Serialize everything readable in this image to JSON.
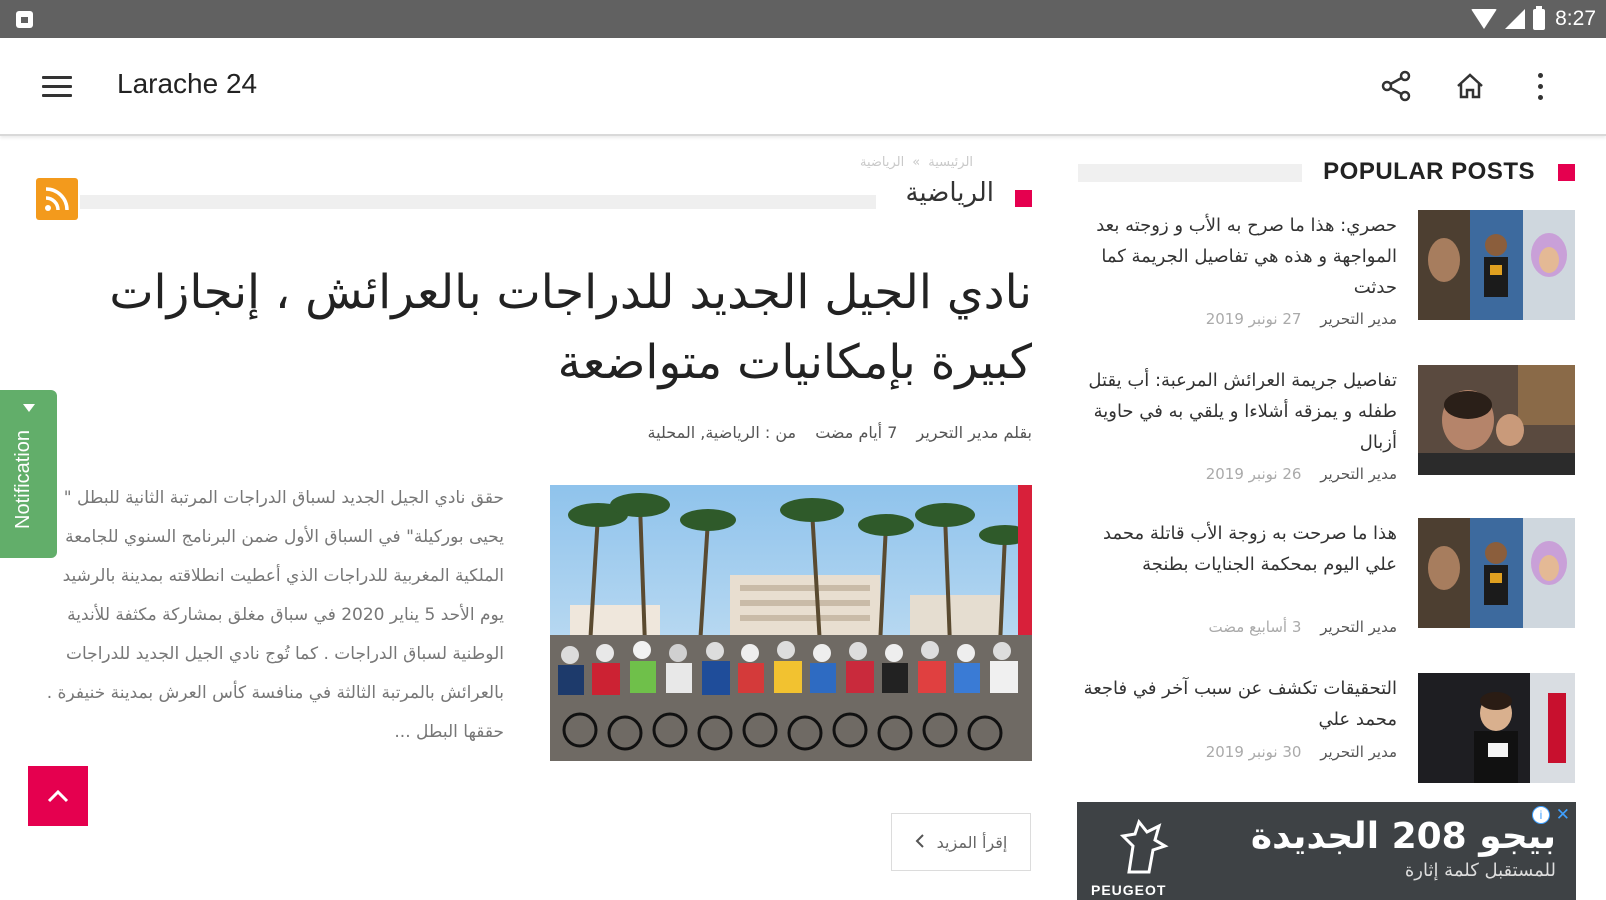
{
  "status_bar": {
    "time": "8:27"
  },
  "app_bar": {
    "title": "Larache 24"
  },
  "breadcrumb": {
    "home": "الرئيسية",
    "separator": "»",
    "current": "الرياضية"
  },
  "category": {
    "title": "الرياضية"
  },
  "post": {
    "title": "نادي الجيل الجديد للدراجات بالعرائش ، إنجازات كبيرة بإمكانيات متواضعة",
    "author": "بقلم مدير التحرير",
    "time": "7 أيام مضت",
    "categories": "من : الرياضية, المحلية",
    "excerpt": "حقق نادي الجيل الجديد لسباق الدراجات المرتبة الثانية للبطل \" يحيى بوركيلة\" في السباق الأول ضمن البرنامج السنوي للجامعة الملكية المغربية للدراجات الذي أعطيت انطلاقته بمدينة بالرشيد يوم الأحد 5 يناير 2020 في سباق مغلق بمشاركة مكثفة للأندية الوطنية لسباق الدراجات . كما تُوج نادي الجيل الجديد للدراجات بالعرائش بالمرتبة الثالثة في منافسة كأس العرش بمدينة خنيفرة . حققها البطل ...",
    "read_more": "إقرأ المزيد"
  },
  "notification": {
    "label": "Notification"
  },
  "popular_posts": {
    "title": "POPULAR POSTS",
    "items": [
      {
        "title": "حصري: هذا ما صرح به الأب و زوجته بعد المواجهة و هذه هي تفاصيل الجريمة كما حدثت",
        "author": "مدير التحرير",
        "date": "27 نونبر 2019"
      },
      {
        "title": "تفاصيل جريمة العرائش المرعبة: أب يقتل طفله و يمزقه أشلاءا و يلقي به في حاوية أزبال",
        "author": "مدير التحرير",
        "date": "26 نونبر 2019"
      },
      {
        "title": "هذا ما صرحت به زوجة الأب قاتلة محمد علي اليوم بمحكمة الجنايات بطنجة",
        "author": "مدير التحرير",
        "date": "3 أسابيع مضت"
      },
      {
        "title": "التحقيقات تكشف عن سبب آخر في فاجعة محمد علي",
        "author": "مدير التحرير",
        "date": "30 نونبر 2019"
      }
    ]
  },
  "ad": {
    "headline": "بيجو 208 الجديدة",
    "subline": "للمستقبل كلمة إثارة",
    "brand": "PEUGEOT"
  },
  "colors": {
    "accent": "#e5004f",
    "rss": "#f39a1c",
    "notification": "#62ae6a",
    "status_bar": "#616161"
  }
}
